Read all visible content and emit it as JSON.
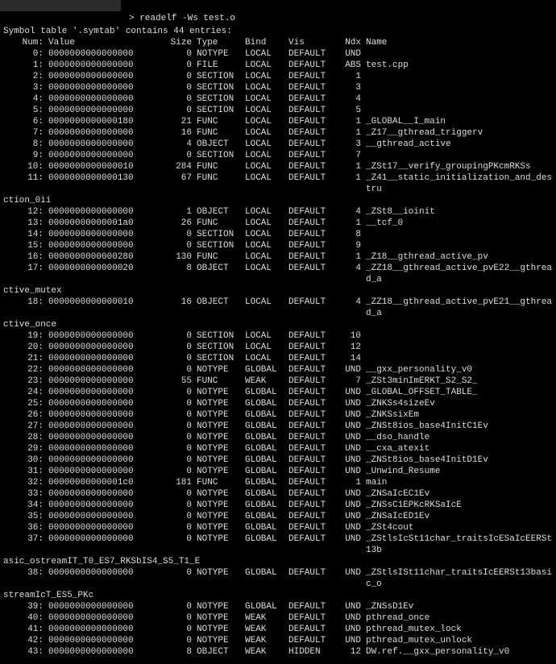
{
  "prompt": "> readelf -Ws test.o",
  "title_line": "Symbol table '.symtab' contains 44 entries:",
  "header": {
    "num": "Num:",
    "val": "Value",
    "size": "Size",
    "type": "Type",
    "bind": "Bind",
    "vis": "Vis",
    "ndx": "Ndx",
    "name": "Name"
  },
  "rows": [
    {
      "n": "0:",
      "v": "0000000000000000",
      "s": "0",
      "t": "NOTYPE",
      "b": "LOCAL",
      "vi": "DEFAULT",
      "x": "UND",
      "nm": ""
    },
    {
      "n": "1:",
      "v": "0000000000000000",
      "s": "0",
      "t": "FILE",
      "b": "LOCAL",
      "vi": "DEFAULT",
      "x": "ABS",
      "nm": "test.cpp"
    },
    {
      "n": "2:",
      "v": "0000000000000000",
      "s": "0",
      "t": "SECTION",
      "b": "LOCAL",
      "vi": "DEFAULT",
      "x": "1",
      "nm": ""
    },
    {
      "n": "3:",
      "v": "0000000000000000",
      "s": "0",
      "t": "SECTION",
      "b": "LOCAL",
      "vi": "DEFAULT",
      "x": "3",
      "nm": ""
    },
    {
      "n": "4:",
      "v": "0000000000000000",
      "s": "0",
      "t": "SECTION",
      "b": "LOCAL",
      "vi": "DEFAULT",
      "x": "4",
      "nm": ""
    },
    {
      "n": "5:",
      "v": "0000000000000000",
      "s": "0",
      "t": "SECTION",
      "b": "LOCAL",
      "vi": "DEFAULT",
      "x": "5",
      "nm": ""
    },
    {
      "n": "6:",
      "v": "0000000000000180",
      "s": "21",
      "t": "FUNC",
      "b": "LOCAL",
      "vi": "DEFAULT",
      "x": "1",
      "nm": "_GLOBAL__I_main"
    },
    {
      "n": "7:",
      "v": "0000000000000000",
      "s": "16",
      "t": "FUNC",
      "b": "LOCAL",
      "vi": "DEFAULT",
      "x": "1",
      "nm": "_Z17__gthread_triggerv"
    },
    {
      "n": "8:",
      "v": "0000000000000000",
      "s": "4",
      "t": "OBJECT",
      "b": "LOCAL",
      "vi": "DEFAULT",
      "x": "3",
      "nm": "__gthread_active"
    },
    {
      "n": "9:",
      "v": "0000000000000000",
      "s": "0",
      "t": "SECTION",
      "b": "LOCAL",
      "vi": "DEFAULT",
      "x": "7",
      "nm": ""
    },
    {
      "n": "10:",
      "v": "0000000000000010",
      "s": "284",
      "t": "FUNC",
      "b": "LOCAL",
      "vi": "DEFAULT",
      "x": "1",
      "nm": "_ZSt17__verify_groupingPKcmRKSs"
    },
    {
      "n": "11:",
      "v": "0000000000000130",
      "s": "67",
      "t": "FUNC",
      "b": "LOCAL",
      "vi": "DEFAULT",
      "x": "1",
      "nm": "_Z41__static_initialization_and_destruction_0ii",
      "wrap": true
    },
    {
      "n": "12:",
      "v": "0000000000000000",
      "s": "1",
      "t": "OBJECT",
      "b": "LOCAL",
      "vi": "DEFAULT",
      "x": "4",
      "nm": "_ZSt8__ioinit"
    },
    {
      "n": "13:",
      "v": "00000000000001a0",
      "s": "26",
      "t": "FUNC",
      "b": "LOCAL",
      "vi": "DEFAULT",
      "x": "1",
      "nm": "__tcf_0"
    },
    {
      "n": "14:",
      "v": "0000000000000000",
      "s": "0",
      "t": "SECTION",
      "b": "LOCAL",
      "vi": "DEFAULT",
      "x": "8",
      "nm": ""
    },
    {
      "n": "15:",
      "v": "0000000000000000",
      "s": "0",
      "t": "SECTION",
      "b": "LOCAL",
      "vi": "DEFAULT",
      "x": "9",
      "nm": ""
    },
    {
      "n": "16:",
      "v": "0000000000000280",
      "s": "130",
      "t": "FUNC",
      "b": "LOCAL",
      "vi": "DEFAULT",
      "x": "1",
      "nm": "_Z18__gthread_active_pv"
    },
    {
      "n": "17:",
      "v": "0000000000000020",
      "s": "8",
      "t": "OBJECT",
      "b": "LOCAL",
      "vi": "DEFAULT",
      "x": "4",
      "nm": "_ZZ18__gthread_active_pvE22__gthread_active_mutex",
      "wrap": true
    },
    {
      "n": "18:",
      "v": "0000000000000010",
      "s": "16",
      "t": "OBJECT",
      "b": "LOCAL",
      "vi": "DEFAULT",
      "x": "4",
      "nm": "_ZZ18__gthread_active_pvE21__gthread_active_once",
      "wrap": true
    },
    {
      "n": "19:",
      "v": "0000000000000000",
      "s": "0",
      "t": "SECTION",
      "b": "LOCAL",
      "vi": "DEFAULT",
      "x": "10",
      "nm": ""
    },
    {
      "n": "20:",
      "v": "0000000000000000",
      "s": "0",
      "t": "SECTION",
      "b": "LOCAL",
      "vi": "DEFAULT",
      "x": "12",
      "nm": ""
    },
    {
      "n": "21:",
      "v": "0000000000000000",
      "s": "0",
      "t": "SECTION",
      "b": "LOCAL",
      "vi": "DEFAULT",
      "x": "14",
      "nm": ""
    },
    {
      "n": "22:",
      "v": "0000000000000000",
      "s": "0",
      "t": "NOTYPE",
      "b": "GLOBAL",
      "vi": "DEFAULT",
      "x": "UND",
      "nm": "__gxx_personality_v0"
    },
    {
      "n": "23:",
      "v": "0000000000000000",
      "s": "55",
      "t": "FUNC",
      "b": "WEAK",
      "vi": "DEFAULT",
      "x": "7",
      "nm": "_ZSt3minImERKT_S2_S2_"
    },
    {
      "n": "24:",
      "v": "0000000000000000",
      "s": "0",
      "t": "NOTYPE",
      "b": "GLOBAL",
      "vi": "DEFAULT",
      "x": "UND",
      "nm": "_GLOBAL_OFFSET_TABLE_"
    },
    {
      "n": "25:",
      "v": "0000000000000000",
      "s": "0",
      "t": "NOTYPE",
      "b": "GLOBAL",
      "vi": "DEFAULT",
      "x": "UND",
      "nm": "_ZNKSs4sizeEv"
    },
    {
      "n": "26:",
      "v": "0000000000000000",
      "s": "0",
      "t": "NOTYPE",
      "b": "GLOBAL",
      "vi": "DEFAULT",
      "x": "UND",
      "nm": "_ZNKSsixEm"
    },
    {
      "n": "27:",
      "v": "0000000000000000",
      "s": "0",
      "t": "NOTYPE",
      "b": "GLOBAL",
      "vi": "DEFAULT",
      "x": "UND",
      "nm": "_ZNSt8ios_base4InitC1Ev"
    },
    {
      "n": "28:",
      "v": "0000000000000000",
      "s": "0",
      "t": "NOTYPE",
      "b": "GLOBAL",
      "vi": "DEFAULT",
      "x": "UND",
      "nm": "__dso_handle"
    },
    {
      "n": "29:",
      "v": "0000000000000000",
      "s": "0",
      "t": "NOTYPE",
      "b": "GLOBAL",
      "vi": "DEFAULT",
      "x": "UND",
      "nm": "__cxa_atexit"
    },
    {
      "n": "30:",
      "v": "0000000000000000",
      "s": "0",
      "t": "NOTYPE",
      "b": "GLOBAL",
      "vi": "DEFAULT",
      "x": "UND",
      "nm": "_ZNSt8ios_base4InitD1Ev"
    },
    {
      "n": "31:",
      "v": "0000000000000000",
      "s": "0",
      "t": "NOTYPE",
      "b": "GLOBAL",
      "vi": "DEFAULT",
      "x": "UND",
      "nm": "_Unwind_Resume"
    },
    {
      "n": "32:",
      "v": "00000000000001c0",
      "s": "181",
      "t": "FUNC",
      "b": "GLOBAL",
      "vi": "DEFAULT",
      "x": "1",
      "nm": "main"
    },
    {
      "n": "33:",
      "v": "0000000000000000",
      "s": "0",
      "t": "NOTYPE",
      "b": "GLOBAL",
      "vi": "DEFAULT",
      "x": "UND",
      "nm": "_ZNSaIcEC1Ev"
    },
    {
      "n": "34:",
      "v": "0000000000000000",
      "s": "0",
      "t": "NOTYPE",
      "b": "GLOBAL",
      "vi": "DEFAULT",
      "x": "UND",
      "nm": "_ZNSsC1EPKcRKSaIcE"
    },
    {
      "n": "35:",
      "v": "0000000000000000",
      "s": "0",
      "t": "NOTYPE",
      "b": "GLOBAL",
      "vi": "DEFAULT",
      "x": "UND",
      "nm": "_ZNSaIcED1Ev"
    },
    {
      "n": "36:",
      "v": "0000000000000000",
      "s": "0",
      "t": "NOTYPE",
      "b": "GLOBAL",
      "vi": "DEFAULT",
      "x": "UND",
      "nm": "_ZSt4cout"
    },
    {
      "n": "37:",
      "v": "0000000000000000",
      "s": "0",
      "t": "NOTYPE",
      "b": "GLOBAL",
      "vi": "DEFAULT",
      "x": "UND",
      "nm": "_ZStlsIcSt11char_traitsIcESaIcEERSt13basic_ostreamIT_T0_ES7_RKSbIS4_S5_T1_E",
      "wrap": true
    },
    {
      "n": "38:",
      "v": "0000000000000000",
      "s": "0",
      "t": "NOTYPE",
      "b": "GLOBAL",
      "vi": "DEFAULT",
      "x": "UND",
      "nm": "_ZStlsISt11char_traitsIcEERSt13basic_ostreamIcT_ES5_PKc",
      "wrap": true
    },
    {
      "n": "39:",
      "v": "0000000000000000",
      "s": "0",
      "t": "NOTYPE",
      "b": "GLOBAL",
      "vi": "DEFAULT",
      "x": "UND",
      "nm": "_ZNSsD1Ev"
    },
    {
      "n": "40:",
      "v": "0000000000000000",
      "s": "0",
      "t": "NOTYPE",
      "b": "WEAK",
      "vi": "DEFAULT",
      "x": "UND",
      "nm": "pthread_once"
    },
    {
      "n": "41:",
      "v": "0000000000000000",
      "s": "0",
      "t": "NOTYPE",
      "b": "WEAK",
      "vi": "DEFAULT",
      "x": "UND",
      "nm": "pthread_mutex_lock"
    },
    {
      "n": "42:",
      "v": "0000000000000000",
      "s": "0",
      "t": "NOTYPE",
      "b": "WEAK",
      "vi": "DEFAULT",
      "x": "UND",
      "nm": "pthread_mutex_unlock"
    },
    {
      "n": "43:",
      "v": "0000000000000000",
      "s": "8",
      "t": "OBJECT",
      "b": "WEAK",
      "vi": "HIDDEN",
      "x": "12",
      "nm": "DW.ref.__gxx_personality_v0"
    }
  ]
}
